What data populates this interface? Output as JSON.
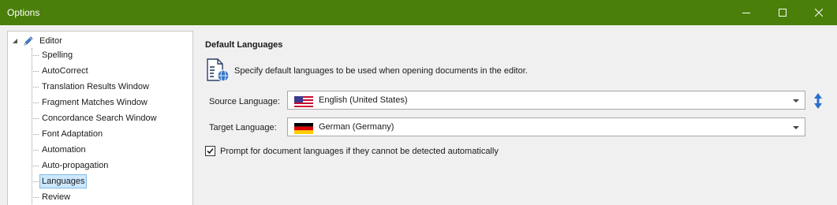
{
  "window": {
    "title": "Options"
  },
  "tree": {
    "root": {
      "label": "Editor",
      "icon": "pencil-icon"
    },
    "items": [
      {
        "label": "Spelling"
      },
      {
        "label": "AutoCorrect"
      },
      {
        "label": "Translation Results Window"
      },
      {
        "label": "Fragment Matches Window"
      },
      {
        "label": "Concordance Search Window"
      },
      {
        "label": "Font Adaptation"
      },
      {
        "label": "Automation"
      },
      {
        "label": "Auto-propagation"
      },
      {
        "label": "Languages",
        "selected": true
      },
      {
        "label": "Review"
      }
    ]
  },
  "panel": {
    "title": "Default Languages",
    "description": "Specify default languages to be used when opening documents in the editor.",
    "source": {
      "label": "Source Language:",
      "value": "English (United States)",
      "flag": "us-flag-icon"
    },
    "target": {
      "label": "Target Language:",
      "value": "German (Germany)",
      "flag": "de-flag-icon"
    },
    "prompt": {
      "label": "Prompt for document languages if they cannot be detected automatically",
      "checked": true
    }
  },
  "colors": {
    "titlebar": "#4a7f0a",
    "selection": "#cce8ff"
  }
}
